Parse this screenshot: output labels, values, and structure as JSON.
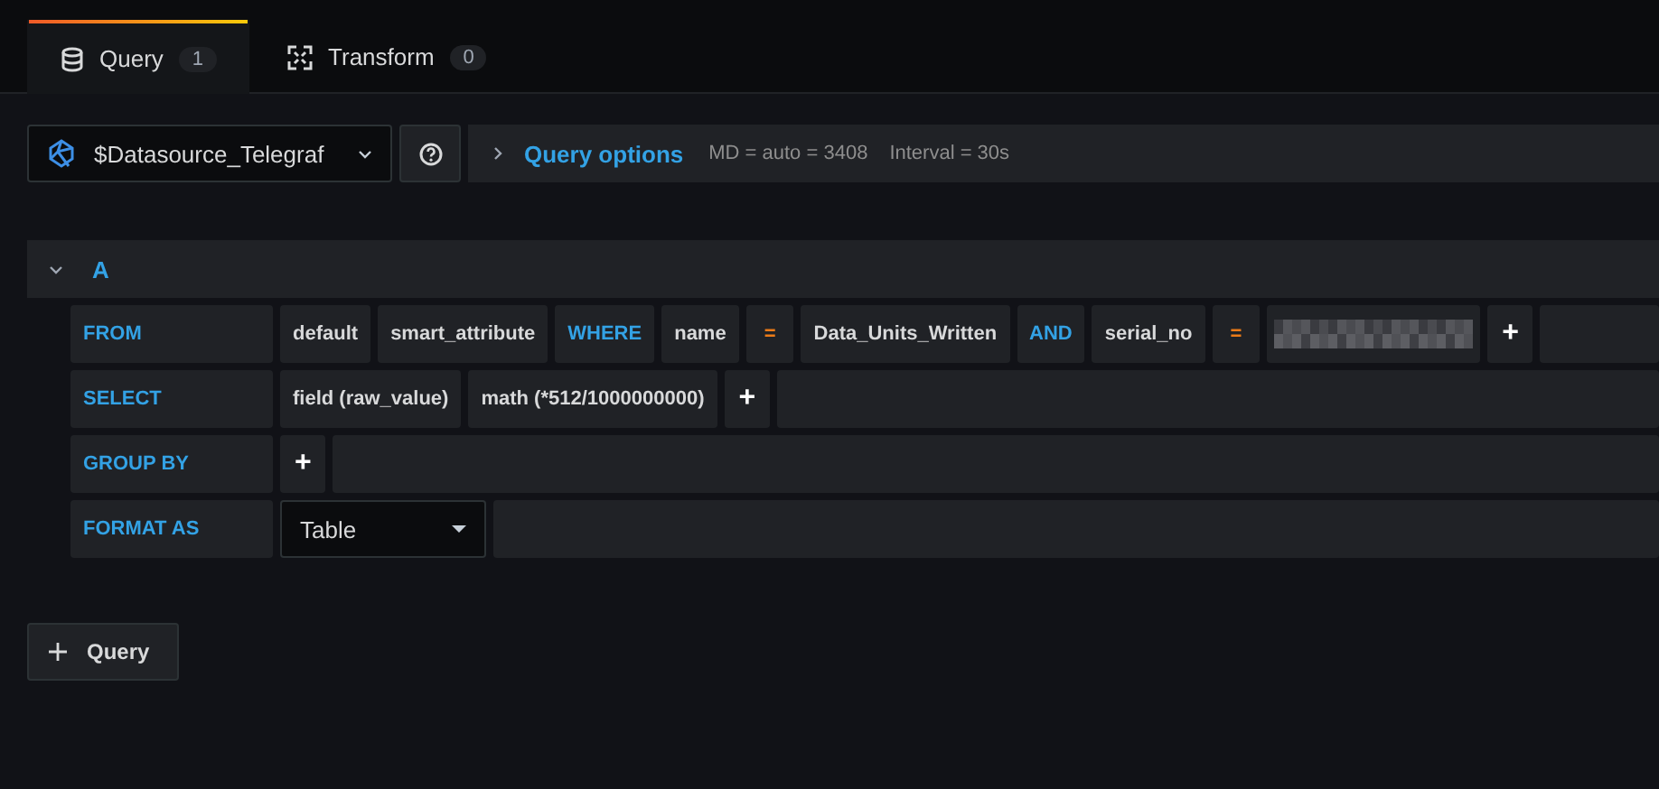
{
  "tabs": [
    {
      "label": "Query",
      "count": "1",
      "selected": true,
      "kind": "database"
    },
    {
      "label": "Transform",
      "count": "0",
      "selected": false,
      "kind": "transform"
    }
  ],
  "datasource": {
    "name": "$Datasource_Telegraf"
  },
  "query_options": {
    "label": "Query options",
    "md": "MD = auto = 3408",
    "interval": "Interval = 30s"
  },
  "query": {
    "ref": "A",
    "expanded": true,
    "rows": [
      {
        "label": "FROM",
        "parts": [
          {
            "kind": "value",
            "text": "default"
          },
          {
            "kind": "value",
            "text": "smart_attribute"
          },
          {
            "kind": "keyword",
            "text": "WHERE"
          },
          {
            "kind": "value",
            "text": "name"
          },
          {
            "kind": "operator",
            "text": "="
          },
          {
            "kind": "value",
            "text": "Data_Units_Written"
          },
          {
            "kind": "keyword",
            "text": "AND"
          },
          {
            "kind": "value",
            "text": "serial_no"
          },
          {
            "kind": "operator",
            "text": "="
          },
          {
            "kind": "redacted"
          },
          {
            "kind": "plus",
            "text": "+"
          }
        ]
      },
      {
        "label": "SELECT",
        "parts": [
          {
            "kind": "value",
            "text": "field (raw_value)"
          },
          {
            "kind": "value",
            "text": "math (*512/1000000000)"
          },
          {
            "kind": "plus",
            "text": "+"
          }
        ]
      },
      {
        "label": "GROUP BY",
        "parts": [
          {
            "kind": "plus",
            "text": "+"
          }
        ]
      },
      {
        "label": "FORMAT AS",
        "parts": [
          {
            "kind": "select",
            "text": "Table"
          }
        ]
      }
    ]
  },
  "add_button": {
    "label": "Query"
  }
}
